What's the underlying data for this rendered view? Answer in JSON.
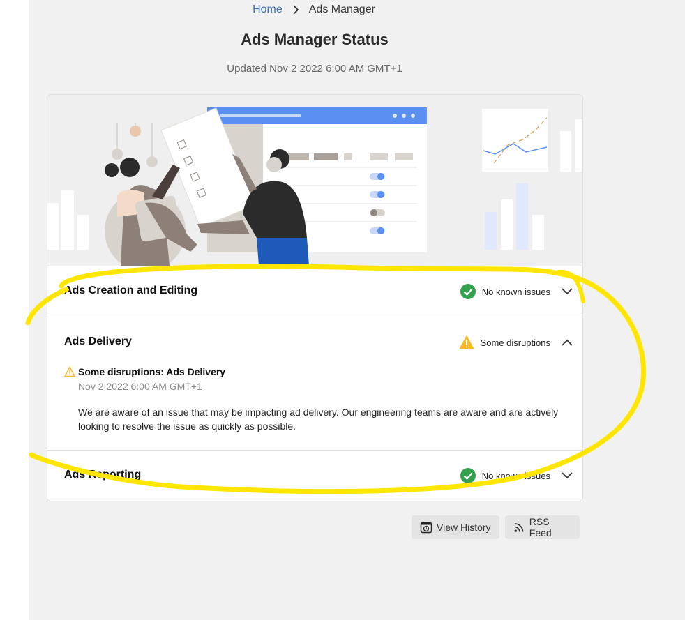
{
  "breadcrumb": {
    "home": "Home",
    "current": "Ads Manager"
  },
  "page": {
    "title": "Ads Manager Status",
    "updated": "Updated Nov 2 2022 6:00 AM GMT+1"
  },
  "services": [
    {
      "name": "Ads Creation and Editing",
      "status": "No known issues",
      "status_icon": "check-circle-icon",
      "expanded": false
    },
    {
      "name": "Ads Delivery",
      "status": "Some disruptions",
      "status_icon": "warning-icon",
      "expanded": true,
      "incident": {
        "title": "Some disruptions: Ads Delivery",
        "time": "Nov 2 2022 6:00 AM GMT+1",
        "body": "We are aware of an issue that may be impacting ad delivery. Our engineering teams are aware and are actively looking to resolve the issue as quickly as possible."
      }
    },
    {
      "name": "Ads Reporting",
      "status": "No known issues",
      "status_icon": "check-circle-icon",
      "expanded": false
    }
  ],
  "actions": {
    "history": "View History",
    "rss": "RSS Feed"
  },
  "colors": {
    "link": "#3b6fb6",
    "ok": "#31a24c",
    "warning": "#f7b928",
    "highlight": "#ffe600"
  }
}
